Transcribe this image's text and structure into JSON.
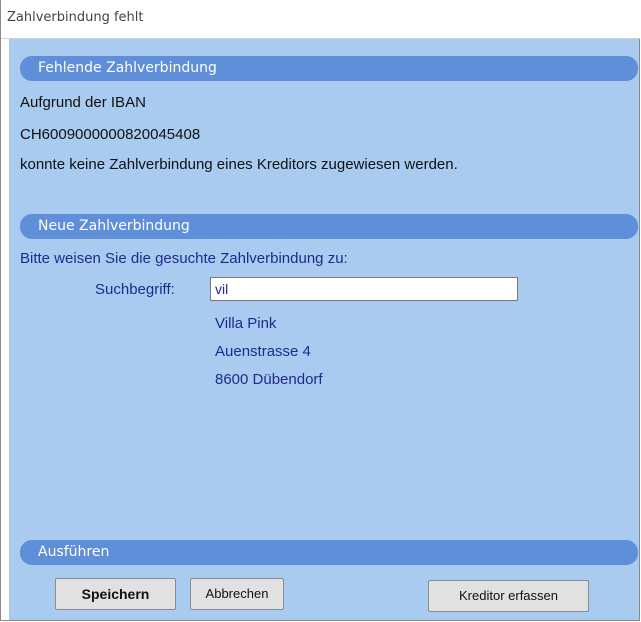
{
  "window": {
    "title": "Zahlverbindung fehlt"
  },
  "section_missing": {
    "header": "Fehlende Zahlverbindung",
    "line1": "Aufgrund der IBAN",
    "iban": "CH6009000000820045408",
    "line3": "konnte keine Zahlverbindung eines Kreditors zugewiesen werden."
  },
  "section_new": {
    "header": "Neue Zahlverbindung",
    "instruction": "Bitte weisen Sie die gesuchte Zahlverbindung zu:",
    "search_label": "Suchbegriff:",
    "search_value": "vil",
    "result": {
      "name": "Villa Pink",
      "street": "Auenstrasse 4",
      "city": "8600 Dübendorf"
    }
  },
  "section_execute": {
    "header": "Ausführen",
    "save_label": "Speichern",
    "cancel_label": "Abbrechen",
    "create_creditor_label": "Kreditor erfassen"
  },
  "colors": {
    "panel_background": "#a9cbf0",
    "section_header": "#5f8fd8",
    "result_text": "#1e2a8c"
  }
}
